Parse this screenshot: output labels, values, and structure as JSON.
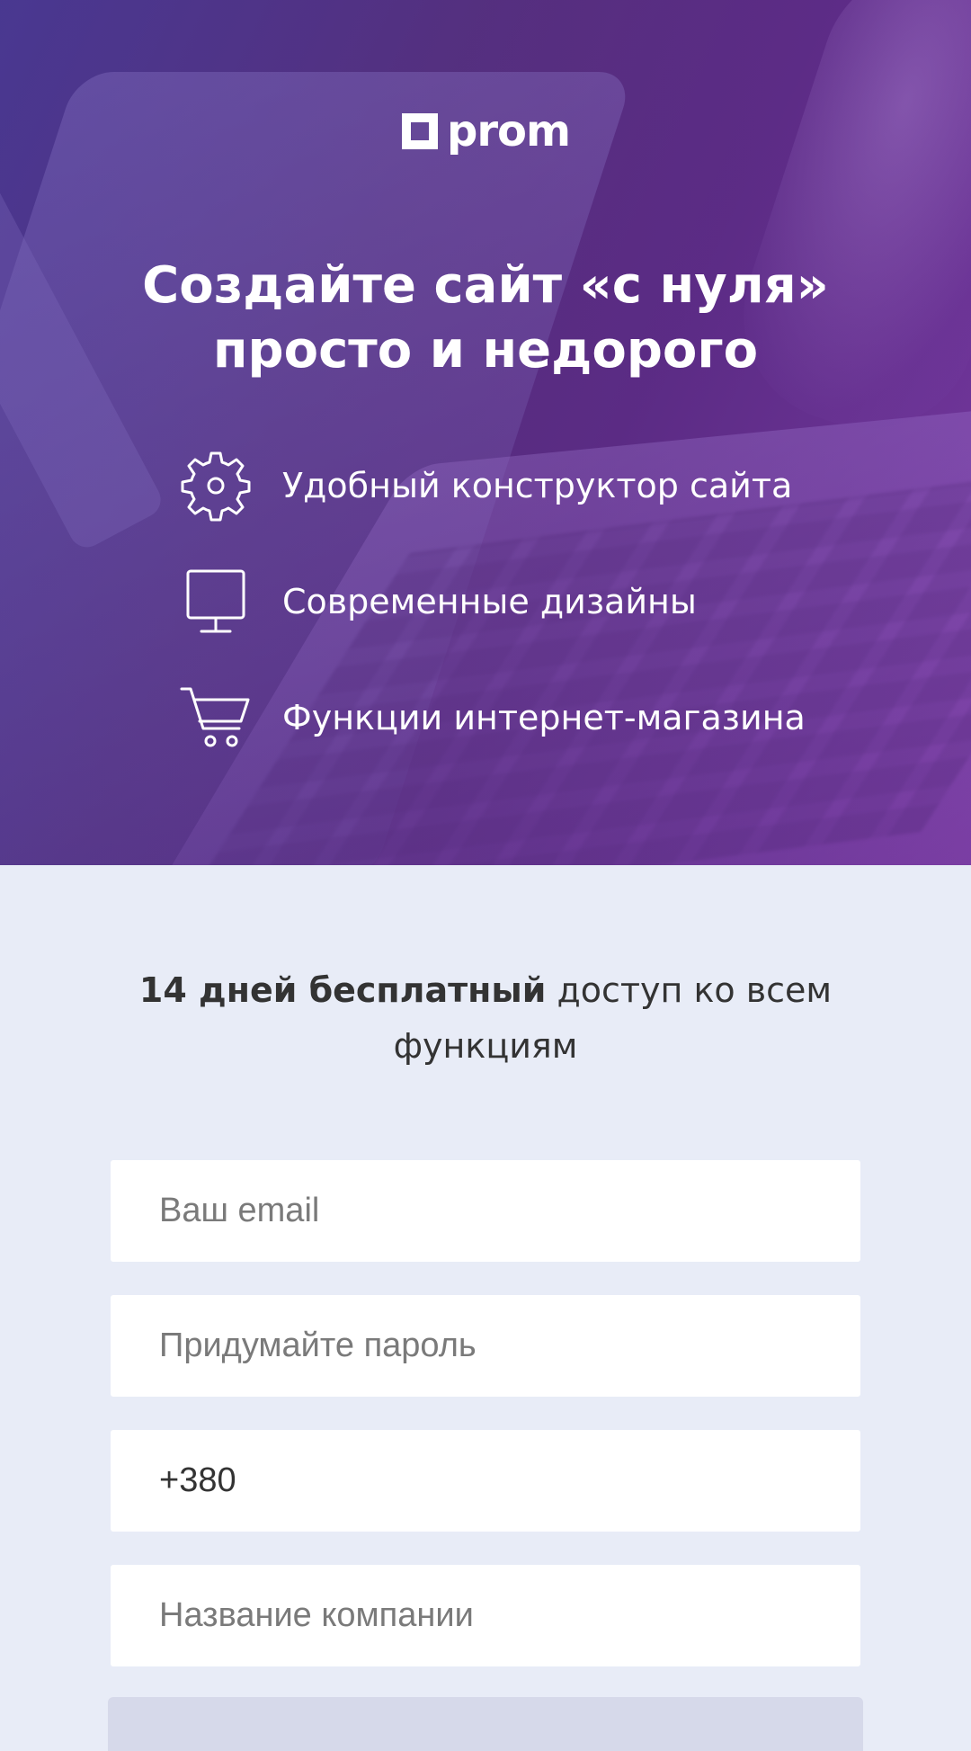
{
  "brand": {
    "logo_text": "prom"
  },
  "hero": {
    "headline_line1": "Создайте сайт «с нуля»",
    "headline_line2": "просто и недорого",
    "features": [
      {
        "icon": "gear-icon",
        "label": "Удобный конструктор сайта"
      },
      {
        "icon": "monitor-icon",
        "label": "Современные дизайны"
      },
      {
        "icon": "cart-icon",
        "label": "Функции интернет-магазина"
      }
    ]
  },
  "promo": {
    "bold": "14 дней бесплатный",
    "rest": " доступ ко всем функциям"
  },
  "form": {
    "email_placeholder": "Ваш email",
    "password_placeholder": "Придумайте пароль",
    "phone_value": "+380",
    "company_placeholder": "Название компании"
  },
  "colors": {
    "hero_gradient_start": "#4a3a93",
    "hero_gradient_end": "#7b3aa1",
    "form_background": "#e8ecf7",
    "text_dark": "#333333"
  }
}
